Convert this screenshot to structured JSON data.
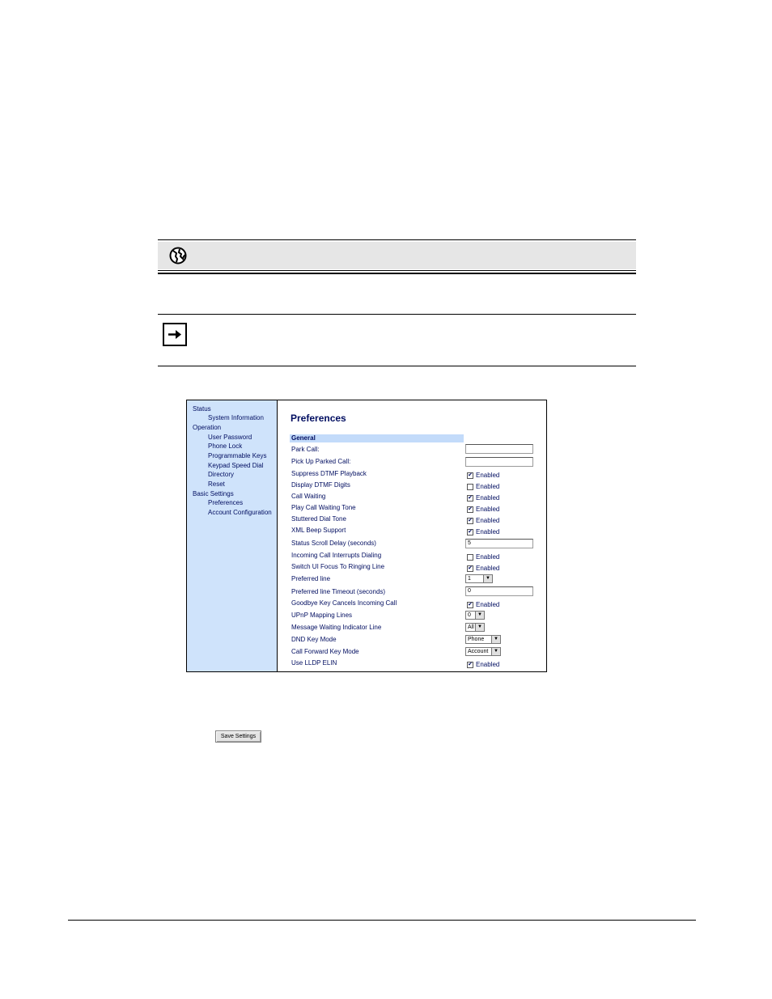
{
  "ui": {
    "sidebar": [
      {
        "label": "Status",
        "level": 0
      },
      {
        "label": "System Information",
        "level": 1
      },
      {
        "label": "Operation",
        "level": 0
      },
      {
        "label": "User Password",
        "level": 1
      },
      {
        "label": "Phone Lock",
        "level": 1
      },
      {
        "label": "Programmable Keys",
        "level": 1
      },
      {
        "label": "Keypad Speed Dial",
        "level": 1
      },
      {
        "label": "Directory",
        "level": 1
      },
      {
        "label": "Reset",
        "level": 1
      },
      {
        "label": "Basic Settings",
        "level": 0
      },
      {
        "label": "Preferences",
        "level": 1
      },
      {
        "label": "Account Configuration",
        "level": 1
      }
    ],
    "title": "Preferences",
    "section": "General",
    "rows": {
      "park_call": {
        "label": "Park Call:",
        "value": ""
      },
      "pick_up_parked_call": {
        "label": "Pick Up Parked Call:",
        "value": ""
      },
      "suppress_dtmf": {
        "label": "Suppress DTMF Playback",
        "checked": "✔",
        "text": "Enabled"
      },
      "display_dtmf": {
        "label": "Display DTMF Digits",
        "checked": "",
        "text": "Enabled"
      },
      "call_waiting": {
        "label": "Call Waiting",
        "checked": "✔",
        "text": "Enabled"
      },
      "play_cw_tone": {
        "label": "Play Call Waiting Tone",
        "checked": "✔",
        "text": "Enabled"
      },
      "stuttered_dial": {
        "label": "Stuttered Dial Tone",
        "checked": "✔",
        "text": "Enabled"
      },
      "xml_beep": {
        "label": "XML Beep Support",
        "checked": "✔",
        "text": "Enabled"
      },
      "status_scroll": {
        "label": "Status Scroll Delay (seconds)",
        "value": "5"
      },
      "incoming_interrupts": {
        "label": "Incoming Call Interrupts Dialing",
        "checked": "",
        "text": "Enabled"
      },
      "switch_focus": {
        "label": "Switch UI Focus To Ringing Line",
        "checked": "✔",
        "text": "Enabled"
      },
      "preferred_line": {
        "label": "Preferred line",
        "value": "1"
      },
      "preferred_timeout": {
        "label": "Preferred line Timeout (seconds)",
        "value": "0"
      },
      "goodbye_cancels": {
        "label": "Goodbye Key Cancels Incoming Call",
        "checked": "✔",
        "text": "Enabled"
      },
      "upnp_lines": {
        "label": "UPnP Mapping Lines",
        "value": "0"
      },
      "mwi_line": {
        "label": "Message Waiting Indicator Line",
        "value": "All"
      },
      "dnd_mode": {
        "label": "DND Key Mode",
        "value": "Phone"
      },
      "cfwd_mode": {
        "label": "Call Forward Key Mode",
        "value": "Account"
      },
      "lldp_elin": {
        "label": "Use LLDP ELIN",
        "checked": "✔",
        "text": "Enabled"
      }
    }
  },
  "save_button": "Save Settings",
  "icons": {
    "webui": "globe-icon",
    "note": "arrow-right-icon",
    "dropdown": "▼"
  }
}
